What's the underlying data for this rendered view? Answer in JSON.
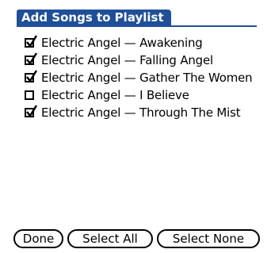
{
  "dialog": {
    "title": "Add Songs to Playlist"
  },
  "songs": [
    {
      "label": "Electric Angel — Awakening",
      "checked": true
    },
    {
      "label": "Electric Angel — Falling Angel",
      "checked": true
    },
    {
      "label": "Electric Angel — Gather The Women",
      "checked": true
    },
    {
      "label": "Electric Angel — I Believe",
      "checked": false
    },
    {
      "label": "Electric Angel — Through The Mist",
      "checked": true
    }
  ],
  "buttons": {
    "done": "Done",
    "select_all": "Select All",
    "select_none": "Select None"
  },
  "colors": {
    "title_background": "#1f4f9a",
    "title_text": "#ffffff"
  },
  "icons": {
    "checked": "checkmark-icon"
  }
}
